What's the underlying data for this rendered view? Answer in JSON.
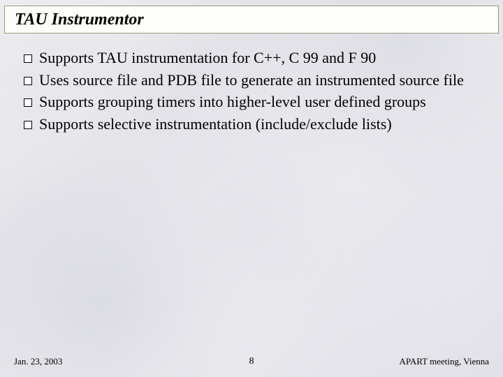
{
  "title": "TAU Instrumentor",
  "bullets": [
    "Supports TAU instrumentation for C++, C 99 and F 90",
    "Uses source file and PDB file to generate an instrumented source file",
    "Supports grouping timers into higher-level user defined groups",
    "Supports selective instrumentation (include/exclude lists)"
  ],
  "footer": {
    "date": "Jan. 23, 2003",
    "page": "8",
    "venue": "APART meeting, Vienna"
  }
}
